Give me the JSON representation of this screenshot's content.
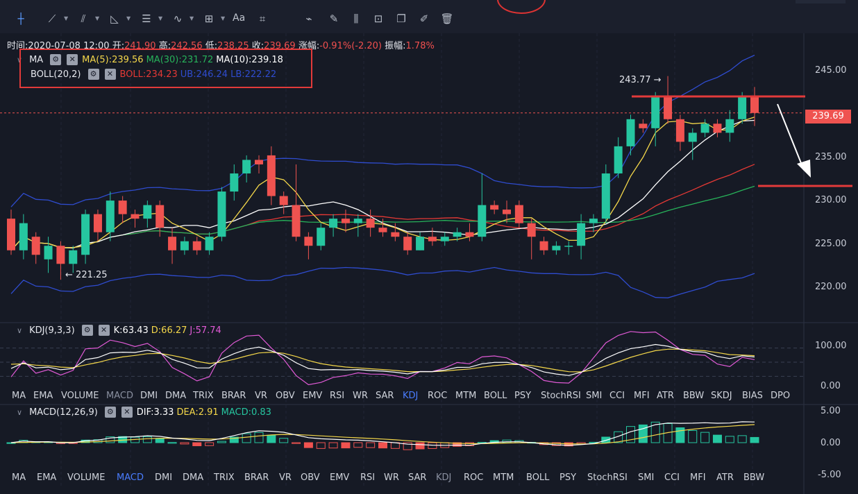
{
  "toolbar": {
    "text_tool_label": "Aa",
    "icons": [
      "crosshair-icon",
      "trend-line-icon",
      "fib-icon",
      "triangle-icon",
      "parallel-lines-icon",
      "wave-icon",
      "measure-icon",
      "text-icon",
      "ruler-icon",
      "brush-icon",
      "pencil-icon",
      "candle-icon",
      "lock-icon",
      "copy-icon",
      "edit-icon",
      "trash-icon"
    ]
  },
  "info_bar": {
    "time_label": "时间:",
    "time_value": "2020-07-08 12:00",
    "open_label": "开:",
    "open_value": "241.90",
    "high_label": "高:",
    "high_value": "242.56",
    "low_label": "低:",
    "low_value": "238.25",
    "close_label": "收:",
    "close_value": "239.69",
    "change_label": "涨幅:",
    "change_value": "-0.91%(-2.20)",
    "amp_label": "振幅:",
    "amp_value": "1.78%"
  },
  "ma_legend": {
    "name": "MA",
    "ma5": "MA(5):239.56",
    "ma30": "MA(30):231.72",
    "ma10": "MA(10):239.18"
  },
  "boll_legend": {
    "name": "BOLL(20,2)",
    "boll": "BOLL:234.23",
    "ub": "UB:246.24",
    "lb": "LB:222.22"
  },
  "kdj_legend": {
    "name": "KDJ(9,3,3)",
    "k": "K:63.43",
    "d": "D:66.27",
    "j": "J:57.74"
  },
  "macd_legend": {
    "name": "MACD(12,26,9)",
    "dif": "DIF:3.33",
    "dea": "DEA:2.91",
    "macd": "MACD:0.83"
  },
  "price_axis": [
    "245.00",
    "235.00",
    "230.00",
    "225.00",
    "220.00"
  ],
  "current_price": "239.69",
  "kdj_axis": [
    "100.00",
    "0.00"
  ],
  "macd_axis": [
    "5.00",
    "0.00",
    "-5.00"
  ],
  "annotations": {
    "high": "243.77",
    "low": "221.25"
  },
  "tabs_row1": [
    "MA",
    "EMA",
    "VOLUME",
    "MACD",
    "DMI",
    "DMA",
    "TRIX",
    "BRAR",
    "VR",
    "OBV",
    "EMV",
    "RSI",
    "WR",
    "SAR",
    "KDJ",
    "ROC",
    "MTM",
    "BOLL",
    "PSY",
    "StochRSI",
    "SMI",
    "CCI",
    "MFI",
    "ATR",
    "BBW",
    "SKDJ",
    "BIAS",
    "DPO"
  ],
  "tabs_row1_active": "KDJ",
  "tabs_row1_dim": "MACD",
  "tabs_row2": [
    "MA",
    "EMA",
    "VOLUME",
    "MACD",
    "DMI",
    "DMA",
    "TRIX",
    "BRAR",
    "VR",
    "OBV",
    "EMV",
    "RSI",
    "WR",
    "SAR",
    "KDJ",
    "ROC",
    "MTM",
    "BOLL",
    "PSY",
    "StochRSI",
    "SMI",
    "CCI",
    "MFI",
    "ATR",
    "BBW"
  ],
  "tabs_row2_active": "MACD",
  "tabs_row2_dim": "KDJ",
  "colors": {
    "up": "#26c6a0",
    "down": "#ef5350",
    "ma5": "#f5d84a",
    "ma10": "#ffffff",
    "ma30": "#27b35a",
    "boll_mid": "#e53935",
    "boll_band": "#2f4ccf",
    "kdj_k": "#ffffff",
    "kdj_d": "#f5d84a",
    "kdj_j": "#e05ad6",
    "annotation": "#e23a3a"
  },
  "chart_data": {
    "type": "candlestick",
    "ylim": [
      216.5,
      248.5
    ],
    "hline_price": 239.69,
    "candles": [
      [
        228,
        224.5,
        229,
        224
      ],
      [
        224.5,
        227.5,
        228.5,
        223.5
      ],
      [
        226,
        224,
        226.5,
        223
      ],
      [
        223.5,
        225,
        226,
        222
      ],
      [
        225,
        223,
        225.5,
        221.25
      ],
      [
        223,
        224.5,
        225,
        222
      ],
      [
        224,
        228.5,
        229,
        223
      ],
      [
        228.5,
        226.5,
        229,
        225.5
      ],
      [
        226.5,
        230,
        231,
        225.5
      ],
      [
        230,
        228.5,
        230.5,
        227.5
      ],
      [
        228.5,
        228,
        229,
        227
      ],
      [
        228,
        229.5,
        230,
        227
      ],
      [
        229.5,
        227,
        230,
        226
      ],
      [
        226,
        224.5,
        227,
        223
      ],
      [
        224.5,
        225.5,
        226,
        224
      ],
      [
        225.5,
        224.5,
        226,
        224
      ],
      [
        224.5,
        226,
        226.5,
        224
      ],
      [
        226,
        231,
        231.5,
        225.5
      ],
      [
        231,
        233,
        234,
        230
      ],
      [
        233,
        234.5,
        235,
        232
      ],
      [
        234.5,
        234,
        235,
        233
      ],
      [
        235,
        230.5,
        236,
        229.5
      ],
      [
        230.5,
        229.5,
        231,
        228.5
      ],
      [
        229.5,
        226,
        234,
        225.5
      ],
      [
        226,
        225,
        226.5,
        223.5
      ],
      [
        225,
        227,
        227.5,
        224.5
      ],
      [
        227,
        228,
        228.5,
        226
      ],
      [
        228,
        227.5,
        229,
        226.5
      ],
      [
        227.5,
        228,
        228.5,
        226
      ],
      [
        228,
        227,
        229,
        226
      ],
      [
        227,
        226.5,
        228,
        226
      ],
      [
        226.5,
        226,
        227.5,
        225.5
      ],
      [
        226,
        224.5,
        226.5,
        224
      ],
      [
        224.5,
        226,
        226.5,
        224.5
      ],
      [
        226,
        225.5,
        227,
        225
      ],
      [
        225.5,
        226,
        226.5,
        225
      ],
      [
        226,
        226.5,
        227,
        225.5
      ],
      [
        226.5,
        226,
        227.5,
        225.5
      ],
      [
        226,
        229.5,
        233,
        225.5
      ],
      [
        229.5,
        229,
        230,
        228.5
      ],
      [
        229,
        228.5,
        230,
        227.5
      ],
      [
        229.5,
        227.5,
        230,
        227
      ],
      [
        227.5,
        226,
        228,
        223.5
      ],
      [
        225.5,
        224.5,
        226,
        224
      ],
      [
        224.5,
        225,
        225.5,
        224
      ],
      [
        225,
        225,
        225.5,
        224
      ],
      [
        225,
        227.5,
        228.5,
        223.5
      ],
      [
        227.5,
        228,
        228.5,
        226.5
      ],
      [
        228,
        233,
        234,
        227.5
      ],
      [
        233,
        236,
        237,
        232.5
      ],
      [
        236,
        239,
        239.5,
        235
      ],
      [
        238.5,
        238,
        239,
        237.5
      ],
      [
        238,
        241.5,
        242,
        236
      ],
      [
        241.5,
        239,
        243.77,
        238.5
      ],
      [
        239,
        236.5,
        239.5,
        235.5
      ],
      [
        236.5,
        237.5,
        238,
        234.5
      ],
      [
        237.5,
        238.5,
        239,
        237
      ],
      [
        238.5,
        237.5,
        239,
        237
      ],
      [
        237.5,
        239,
        240,
        236.5
      ],
      [
        239,
        241.5,
        242,
        238.5
      ],
      [
        241.5,
        239.69,
        242.56,
        238.25
      ]
    ]
  }
}
